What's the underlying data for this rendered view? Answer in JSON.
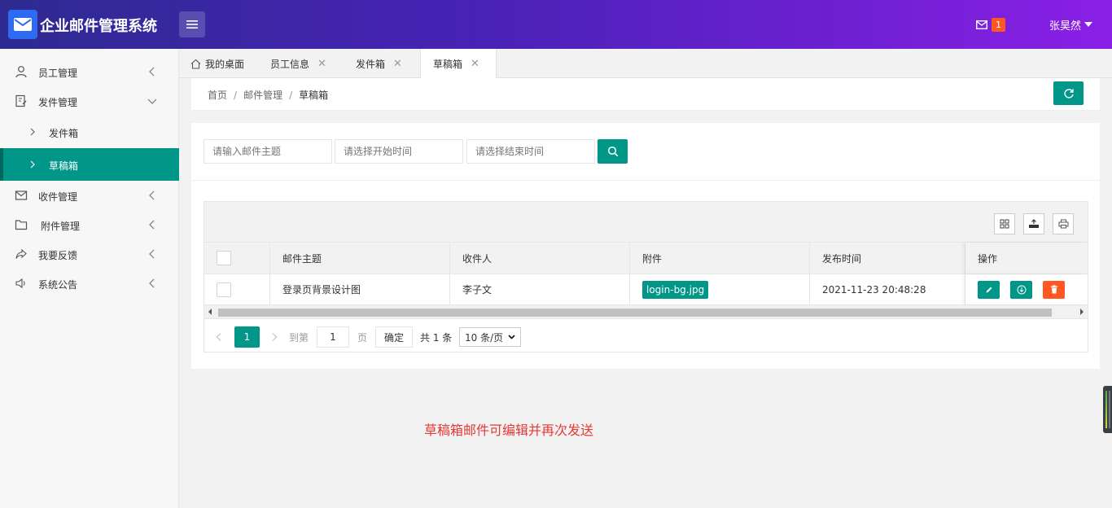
{
  "header": {
    "app_title": "企业邮件管理系统",
    "mail_count": "1",
    "user_name": "张昊然"
  },
  "sidebar": {
    "items": [
      {
        "label": "员工管理",
        "icon": "user-icon",
        "expanded": false
      },
      {
        "label": "发件管理",
        "icon": "edit-doc-icon",
        "expanded": true
      },
      {
        "label": "发件箱",
        "sub": true
      },
      {
        "label": "草稿箱",
        "sub": true,
        "active": true
      },
      {
        "label": "收件管理",
        "icon": "envelope-icon",
        "expanded": false
      },
      {
        "label": "附件管理",
        "icon": "folder-icon",
        "expanded": false
      },
      {
        "label": "我要反馈",
        "icon": "share-icon",
        "expanded": false
      },
      {
        "label": "系统公告",
        "icon": "speaker-icon",
        "expanded": false
      }
    ]
  },
  "tabs": [
    {
      "label": "我的桌面",
      "icon": "home-icon"
    },
    {
      "label": "员工信息",
      "closable": true
    },
    {
      "label": "发件箱",
      "closable": true
    },
    {
      "label": "草稿箱",
      "closable": true,
      "active": true
    }
  ],
  "breadcrumb": {
    "items": [
      "首页",
      "邮件管理",
      "草稿箱"
    ],
    "separator": "/"
  },
  "search": {
    "subject_placeholder": "请输入邮件主题",
    "start_placeholder": "请选择开始时间",
    "end_placeholder": "请选择结束时间"
  },
  "table": {
    "columns": [
      "邮件主题",
      "收件人",
      "附件",
      "发布时间",
      "操作"
    ],
    "rows": [
      {
        "subject": "登录页背景设计图",
        "recipient": "李子文",
        "attachment": "login-bg.jpg",
        "time": "2021-11-23 20:48:28"
      }
    ]
  },
  "pager": {
    "current": "1",
    "goto_label": "到第",
    "page_value": "1",
    "page_unit": "页",
    "confirm_label": "确定",
    "total_label": "共 1 条",
    "page_size": "10 条/页"
  },
  "note": "草稿箱邮件可编辑并再次发送",
  "colors": {
    "primary": "#009688",
    "danger": "#ff5722",
    "note": "#e53935"
  }
}
